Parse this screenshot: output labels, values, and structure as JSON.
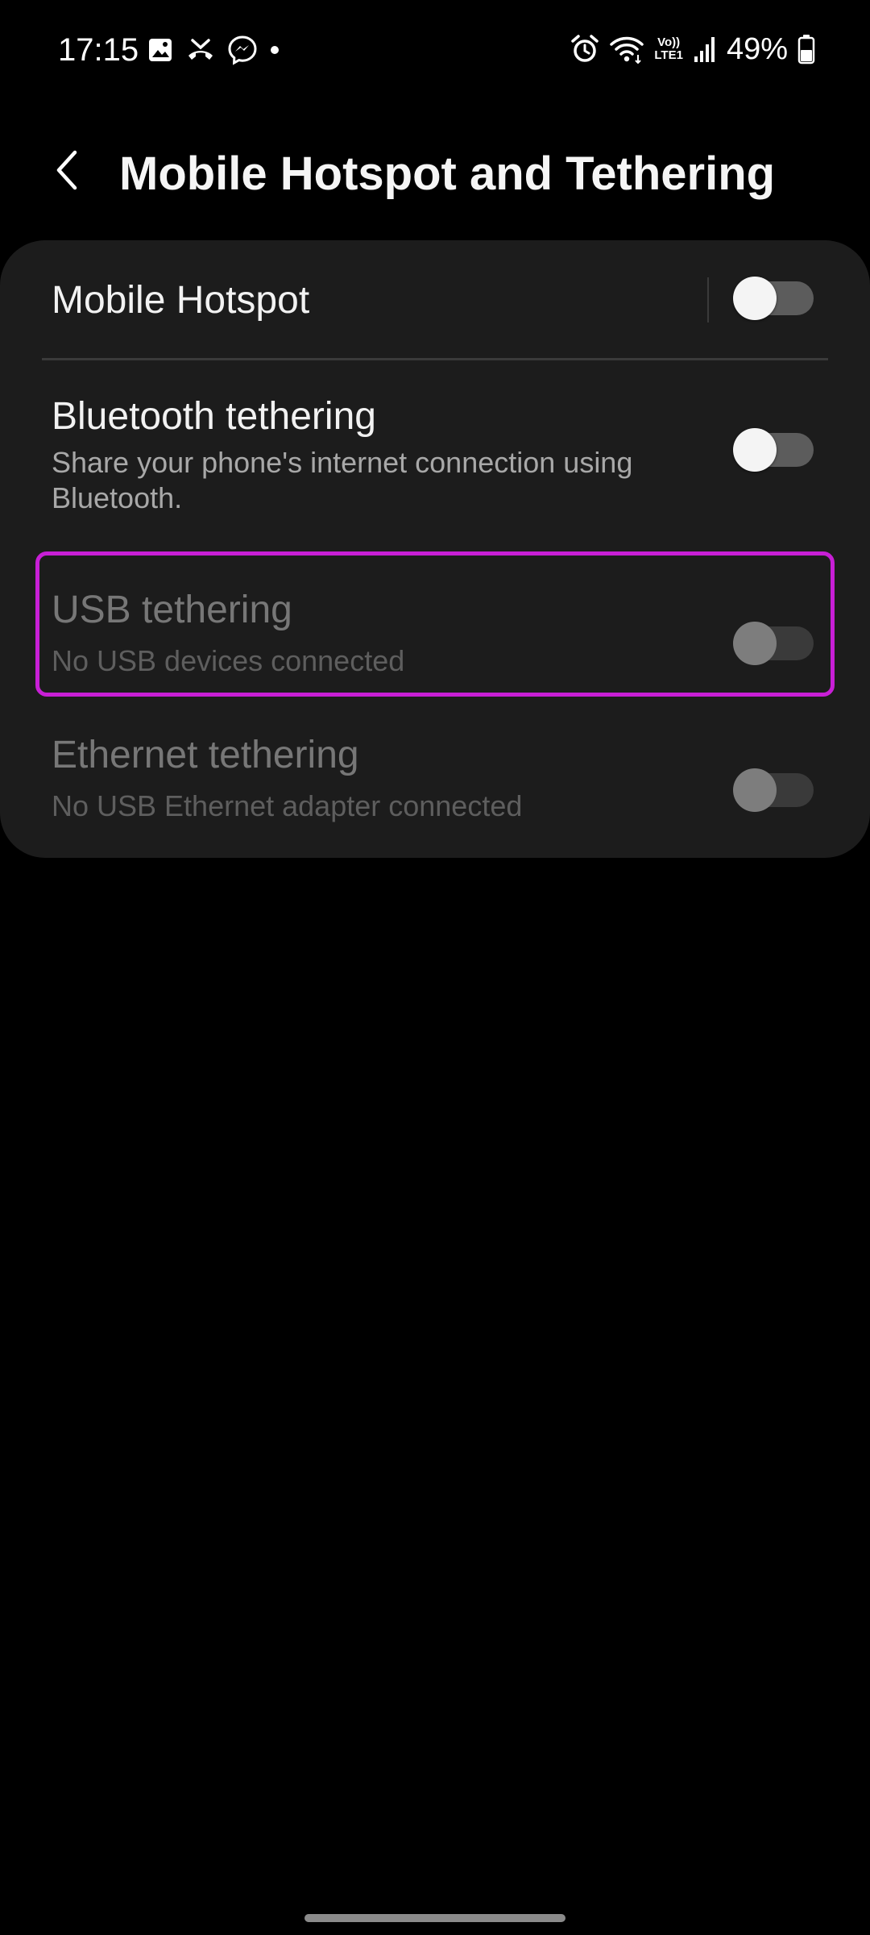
{
  "status_bar": {
    "time": "17:15",
    "left_icons": [
      "gallery-icon",
      "missed-call-icon",
      "messenger-icon",
      "notification-dot-icon"
    ],
    "right_icons": [
      "alarm-icon",
      "wifi-icon",
      "volte-lte-icon",
      "signal-icon",
      "battery-icon"
    ],
    "volte_top": "Vo))",
    "volte_bottom": "LTE1",
    "battery_percent": "49%",
    "battery_level": 0.49
  },
  "header": {
    "back_icon": "chevron-left-icon",
    "title": "Mobile Hotspot and Tethering"
  },
  "settings": {
    "mobile_hotspot": {
      "title": "Mobile Hotspot",
      "enabled": false
    },
    "bluetooth_tethering": {
      "title": "Bluetooth tethering",
      "subtitle": "Share your phone's internet connection using Bluetooth.",
      "enabled": false
    },
    "usb_tethering": {
      "title": "USB tethering",
      "subtitle": "No USB devices connected",
      "enabled": false,
      "available": false,
      "highlighted": true
    },
    "ethernet_tethering": {
      "title": "Ethernet tethering",
      "subtitle": "No USB Ethernet adapter connected",
      "enabled": false,
      "available": false
    }
  },
  "colors": {
    "background": "#000000",
    "card": "#1c1c1c",
    "highlight": "#c81fd6",
    "toggle_track_off": "#5c5c5c",
    "toggle_knob": "#f4f4f4"
  }
}
